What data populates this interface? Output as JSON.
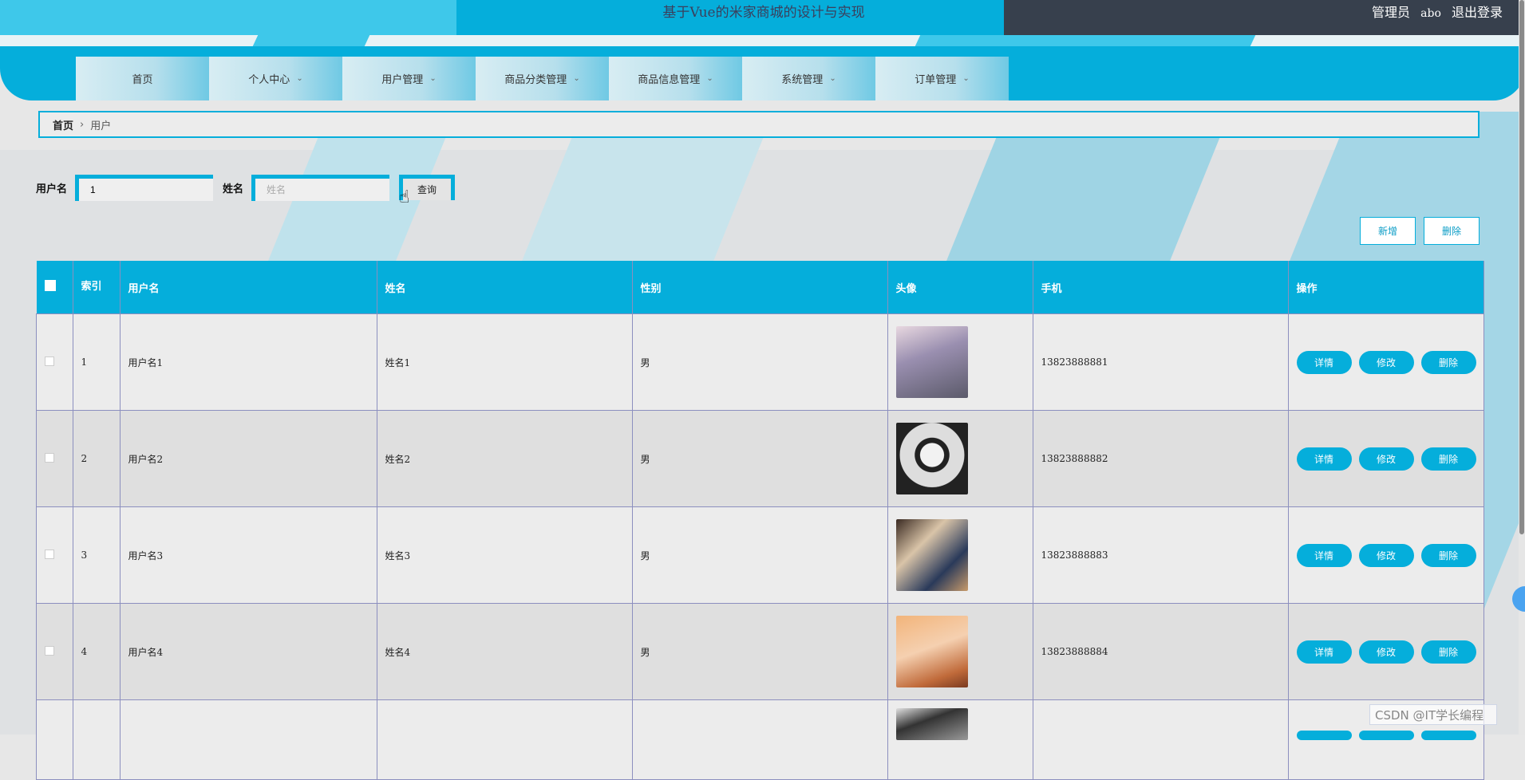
{
  "header": {
    "title": "基于Vue的米家商城的设计与实现",
    "role": "管理员",
    "username": "abo",
    "logout": "退出登录"
  },
  "nav": {
    "items": [
      {
        "label": "首页",
        "has_dropdown": false
      },
      {
        "label": "个人中心",
        "has_dropdown": true
      },
      {
        "label": "用户管理",
        "has_dropdown": true
      },
      {
        "label": "商品分类管理",
        "has_dropdown": true
      },
      {
        "label": "商品信息管理",
        "has_dropdown": true
      },
      {
        "label": "系统管理",
        "has_dropdown": true
      },
      {
        "label": "订单管理",
        "has_dropdown": true
      }
    ]
  },
  "breadcrumb": {
    "home": "首页",
    "current": "用户"
  },
  "search": {
    "username_label": "用户名",
    "username_value": "1",
    "name_label": "姓名",
    "name_placeholder": "姓名",
    "button": "查询"
  },
  "actions": {
    "add": "新增",
    "delete": "删除"
  },
  "table": {
    "headers": {
      "index": "索引",
      "username": "用户名",
      "name": "姓名",
      "gender": "性别",
      "avatar": "头像",
      "phone": "手机",
      "ops": "操作"
    },
    "row_actions": {
      "detail": "详情",
      "edit": "修改",
      "delete": "删除"
    },
    "rows": [
      {
        "index": "1",
        "username": "用户名1",
        "name": "姓名1",
        "gender": "男",
        "phone": "13823888881"
      },
      {
        "index": "2",
        "username": "用户名2",
        "name": "姓名2",
        "gender": "男",
        "phone": "13823888882"
      },
      {
        "index": "3",
        "username": "用户名3",
        "name": "姓名3",
        "gender": "男",
        "phone": "13823888883"
      },
      {
        "index": "4",
        "username": "用户名4",
        "name": "姓名4",
        "gender": "男",
        "phone": "13823888884"
      }
    ]
  },
  "watermark": "CSDN @IT学长编程",
  "colors": {
    "accent": "#05aedb",
    "header_dark": "#37404d"
  }
}
